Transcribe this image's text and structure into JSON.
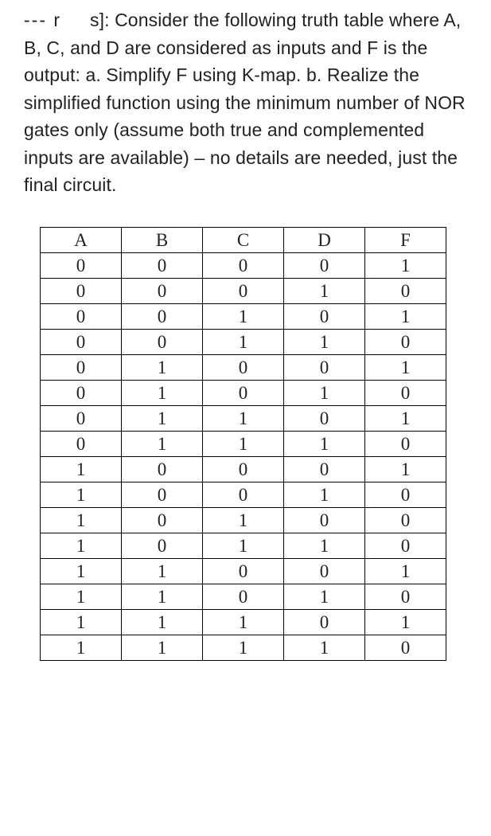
{
  "prompt": {
    "prefix": "--- r",
    "body": "s]: Consider the following truth table where A, B, C, and D are considered as inputs and F is the output: a. Simplify F using K-map. b. Realize the simplified function using the minimum number of NOR gates only (assume both true and complemented inputs are available) – no details are needed, just the final circuit."
  },
  "chart_data": {
    "type": "table",
    "headers": [
      "A",
      "B",
      "C",
      "D",
      "F"
    ],
    "rows": [
      [
        "0",
        "0",
        "0",
        "0",
        "1"
      ],
      [
        "0",
        "0",
        "0",
        "1",
        "0"
      ],
      [
        "0",
        "0",
        "1",
        "0",
        "1"
      ],
      [
        "0",
        "0",
        "1",
        "1",
        "0"
      ],
      [
        "0",
        "1",
        "0",
        "0",
        "1"
      ],
      [
        "0",
        "1",
        "0",
        "1",
        "0"
      ],
      [
        "0",
        "1",
        "1",
        "0",
        "1"
      ],
      [
        "0",
        "1",
        "1",
        "1",
        "0"
      ],
      [
        "1",
        "0",
        "0",
        "0",
        "1"
      ],
      [
        "1",
        "0",
        "0",
        "1",
        "0"
      ],
      [
        "1",
        "0",
        "1",
        "0",
        "0"
      ],
      [
        "1",
        "0",
        "1",
        "1",
        "0"
      ],
      [
        "1",
        "1",
        "0",
        "0",
        "1"
      ],
      [
        "1",
        "1",
        "0",
        "1",
        "0"
      ],
      [
        "1",
        "1",
        "1",
        "0",
        "1"
      ],
      [
        "1",
        "1",
        "1",
        "1",
        "0"
      ]
    ]
  }
}
